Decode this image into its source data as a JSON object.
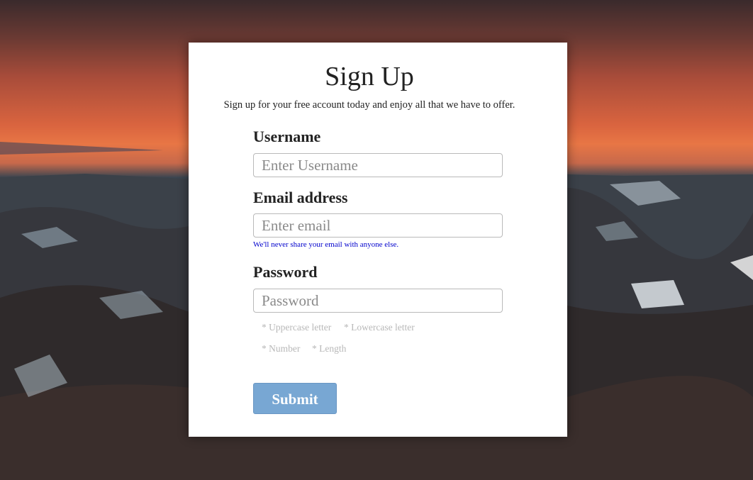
{
  "colors": {
    "card_background": "#ffffff",
    "title_text": "#222222",
    "help_text": "#0000cc",
    "requirement_text": "#b8b8b8",
    "submit_background": "#78a7d3",
    "submit_text": "#ffffff"
  },
  "form": {
    "title": "Sign Up",
    "subtitle": "Sign up for your free account today and enjoy all that we have to offer.",
    "username": {
      "label": "Username",
      "value": "",
      "placeholder": "Enter Username"
    },
    "email": {
      "label": "Email address",
      "value": "",
      "placeholder": "Enter email",
      "help": "We'll never share your email with anyone else."
    },
    "password": {
      "label": "Password",
      "value": "",
      "placeholder": "Password",
      "requirements": [
        "* Uppercase letter",
        "* Lowercase letter",
        "* Number",
        "* Length"
      ]
    },
    "submit_label": "Submit"
  }
}
